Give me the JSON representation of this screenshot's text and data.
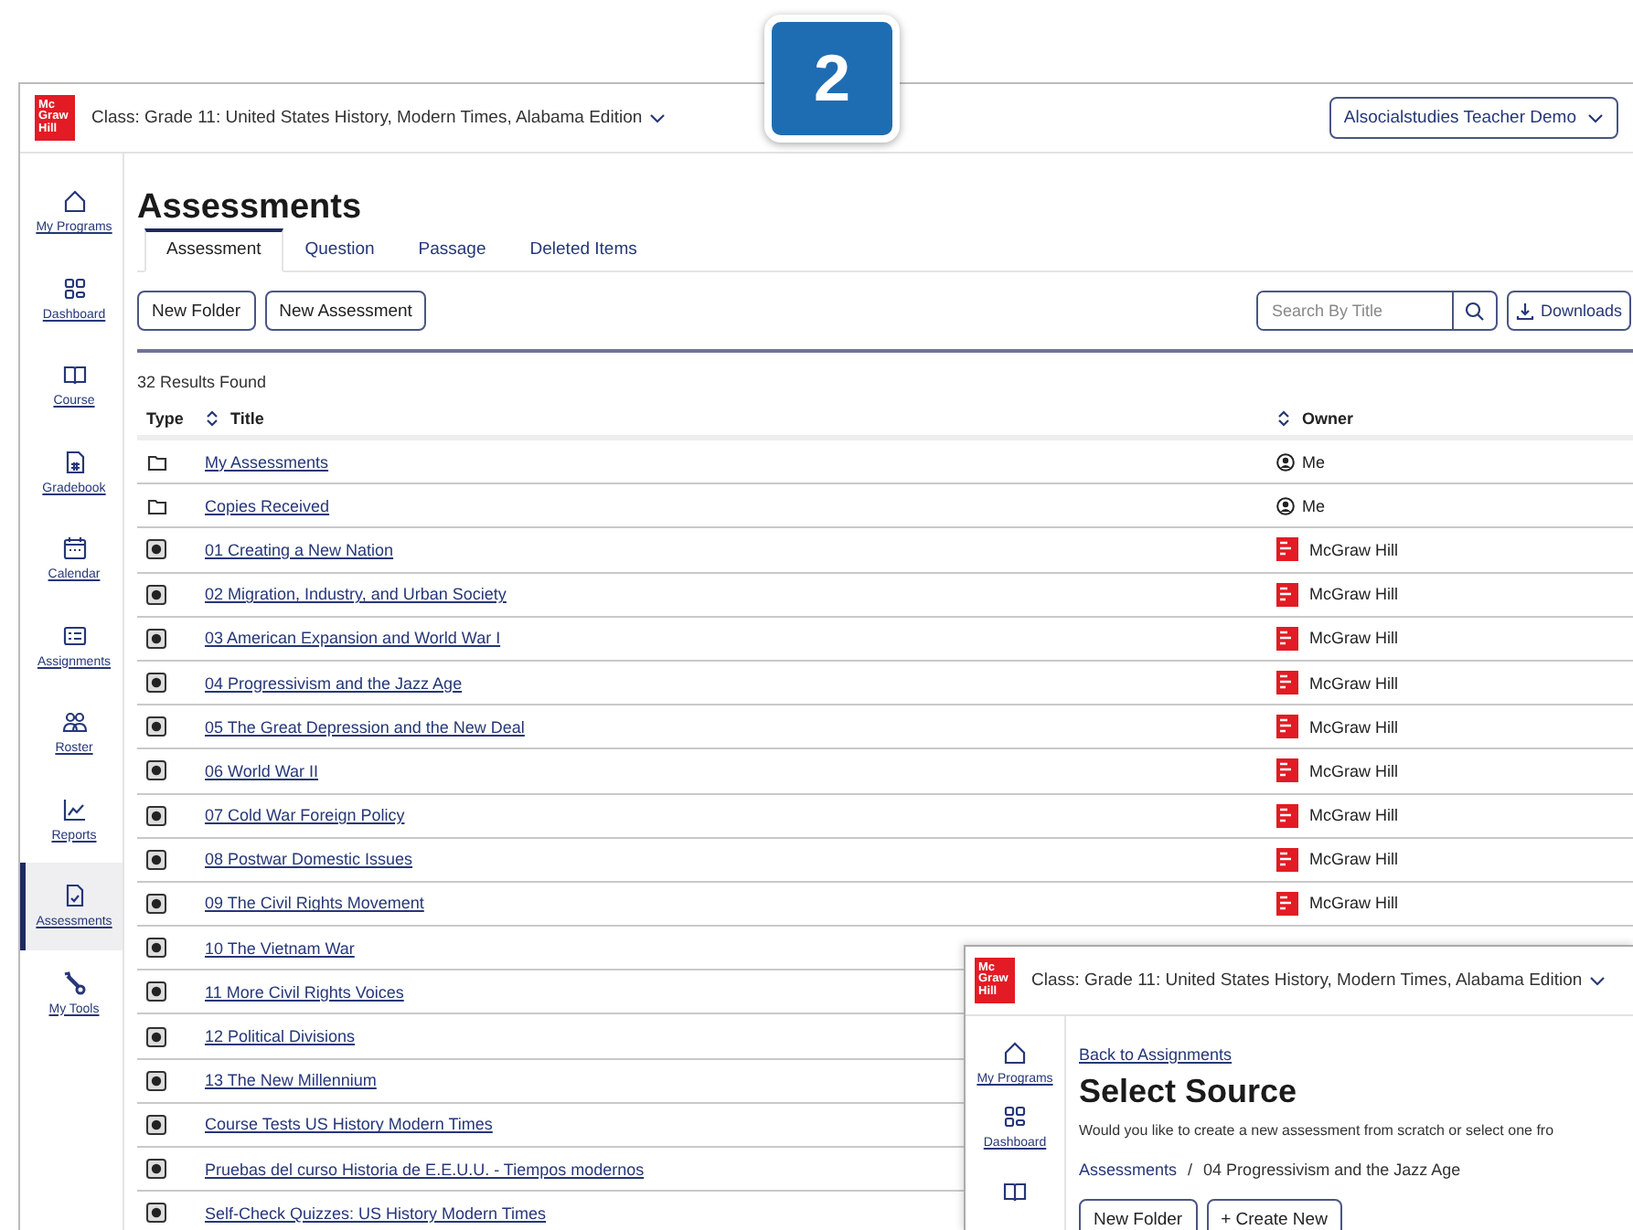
{
  "badge": {
    "label": "2"
  },
  "main_window": {
    "logo_text": [
      "Mc",
      "Graw",
      "Hill"
    ],
    "class_selector": "Class: Grade 11: United States History, Modern Times, Alabama Edition",
    "user_menu": "Alsocialstudies Teacher Demo",
    "sidebar": {
      "items": [
        {
          "label": "My Programs",
          "selected": false
        },
        {
          "label": "Dashboard",
          "selected": false
        },
        {
          "label": "Course",
          "selected": false
        },
        {
          "label": "Gradebook",
          "selected": false
        },
        {
          "label": "Calendar",
          "selected": false
        },
        {
          "label": "Assignments",
          "selected": false
        },
        {
          "label": "Roster",
          "selected": false
        },
        {
          "label": "Reports",
          "selected": false
        },
        {
          "label": "Assessments",
          "selected": true
        },
        {
          "label": "My Tools",
          "selected": false
        }
      ]
    },
    "page_title": "Assessments",
    "tabs": [
      {
        "label": "Assessment",
        "selected": true
      },
      {
        "label": "Question",
        "selected": false
      },
      {
        "label": "Passage",
        "selected": false
      },
      {
        "label": "Deleted Items",
        "selected": false
      }
    ],
    "buttons": [
      "New Folder",
      "New Assessment"
    ],
    "search": {
      "placeholder": "Search By Title"
    },
    "downloads_button": "Downloads",
    "results_count": "32 Results Found",
    "table": {
      "columns": [
        "Type",
        "Title",
        "Owner"
      ],
      "rows": [
        {
          "kind": "folder",
          "title": "My Assessments",
          "owner": {
            "kind": "me",
            "name": "Me"
          }
        },
        {
          "kind": "folder",
          "title": "Copies Received",
          "owner": {
            "kind": "me",
            "name": "Me"
          }
        },
        {
          "kind": "assessment",
          "title": "01 Creating a New Nation",
          "owner": {
            "kind": "publisher",
            "name": "McGraw Hill"
          }
        },
        {
          "kind": "assessment",
          "title": "02 Migration, Industry, and Urban Society",
          "owner": {
            "kind": "publisher",
            "name": "McGraw Hill"
          }
        },
        {
          "kind": "assessment",
          "title": "03 American Expansion and World War I",
          "owner": {
            "kind": "publisher",
            "name": "McGraw Hill"
          }
        },
        {
          "kind": "assessment",
          "title": "04 Progressivism and the Jazz Age",
          "owner": {
            "kind": "publisher",
            "name": "McGraw Hill"
          }
        },
        {
          "kind": "assessment",
          "title": "05 The Great Depression and the New Deal",
          "owner": {
            "kind": "publisher",
            "name": "McGraw Hill"
          }
        },
        {
          "kind": "assessment",
          "title": "06 World War II",
          "owner": {
            "kind": "publisher",
            "name": "McGraw Hill"
          }
        },
        {
          "kind": "assessment",
          "title": "07 Cold War Foreign Policy",
          "owner": {
            "kind": "publisher",
            "name": "McGraw Hill"
          }
        },
        {
          "kind": "assessment",
          "title": "08 Postwar Domestic Issues",
          "owner": {
            "kind": "publisher",
            "name": "McGraw Hill"
          }
        },
        {
          "kind": "assessment",
          "title": "09 The Civil Rights Movement",
          "owner": {
            "kind": "publisher",
            "name": "McGraw Hill"
          }
        },
        {
          "kind": "assessment",
          "title": "10 The Vietnam War"
        },
        {
          "kind": "assessment",
          "title": "11 More Civil Rights Voices"
        },
        {
          "kind": "assessment",
          "title": "12 Political Divisions"
        },
        {
          "kind": "assessment",
          "title": "13 The New Millennium"
        },
        {
          "kind": "assessment",
          "title": "Course Tests US History Modern Times"
        },
        {
          "kind": "assessment",
          "title": "Pruebas del curso Historia de E.E.U.U. - Tiempos modernos"
        },
        {
          "kind": "assessment",
          "title": "Self-Check Quizzes: US History Modern Times"
        }
      ]
    }
  },
  "inset_window": {
    "logo_text": [
      "Mc",
      "Graw",
      "Hill"
    ],
    "class_selector": "Class: Grade 11: United States History, Modern Times, Alabama Edition",
    "sidebar": {
      "items": [
        {
          "label": "My Programs"
        },
        {
          "label": "Dashboard"
        }
      ]
    },
    "back_link": "Back to Assignments",
    "page_title": "Select Source",
    "description": "Would you like to create a new assessment from scratch or select one fro",
    "breadcrumb": {
      "root": "Assessments",
      "separator": "/",
      "current": "04 Progressivism and the Jazz Age"
    },
    "buttons": [
      "New Folder",
      "+ Create New"
    ]
  }
}
